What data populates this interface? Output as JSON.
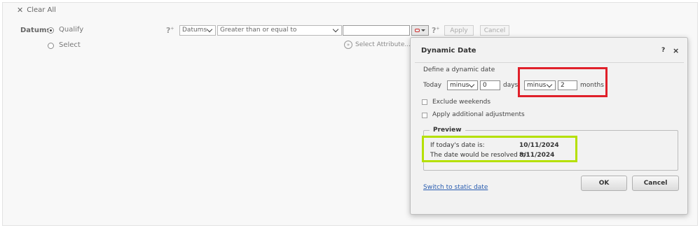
{
  "toolbar": {
    "clear_all": "Clear All"
  },
  "filter": {
    "label": "Datums",
    "radio_qualify": "Qualify",
    "radio_select": "Select",
    "attribute_select": "Datums",
    "operator_select": "Greater than or equal to",
    "value": "",
    "apply": "Apply",
    "cancel": "Cancel",
    "select_attribute": "Select Attribute..."
  },
  "dialog": {
    "title": "Dynamic Date",
    "help": "?",
    "close": "×",
    "define_label": "Define a dynamic date",
    "today_label": "Today",
    "days_op": "minus",
    "days_value": "0",
    "days_label": "days",
    "months_op": "minus",
    "months_value": "2",
    "months_label": "months",
    "exclude_weekends": "Exclude weekends",
    "additional_adjustments": "Apply additional adjustments",
    "preview_title": "Preview",
    "preview_today_label": "If today's date is:",
    "preview_today_value": "10/11/2024",
    "preview_resolved_label": "The date would be resolved to:",
    "preview_resolved_value": "8/11/2024",
    "switch_link": "Switch to static date",
    "ok": "OK",
    "cancel": "Cancel"
  },
  "colors": {
    "highlight_red": "#e0202a",
    "highlight_green": "#b5e000",
    "link": "#2a5db0"
  }
}
